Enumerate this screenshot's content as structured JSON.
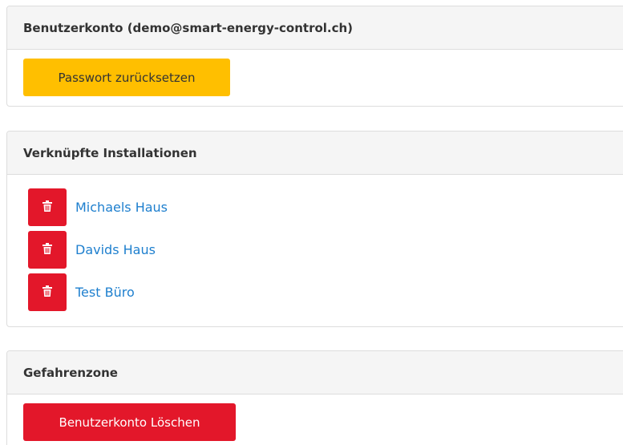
{
  "account": {
    "heading": "Benutzerkonto (demo@smart-energy-control.ch)",
    "reset_password_label": "Passwort zurücksetzen"
  },
  "installations": {
    "heading": "Verknüpfte Installationen",
    "items": [
      {
        "name": "Michaels Haus",
        "delete_icon": "trash-icon"
      },
      {
        "name": "Davids Haus",
        "delete_icon": "trash-icon"
      },
      {
        "name": "Test Büro",
        "delete_icon": "trash-icon"
      }
    ]
  },
  "danger": {
    "heading": "Gefahrenzone",
    "delete_account_label": "Benutzerkonto Löschen"
  },
  "colors": {
    "warning": "#ffbf00",
    "danger": "#e3172a",
    "link": "#1e7fce",
    "panel_heading_bg": "#f5f5f5",
    "border": "#dddddd"
  }
}
